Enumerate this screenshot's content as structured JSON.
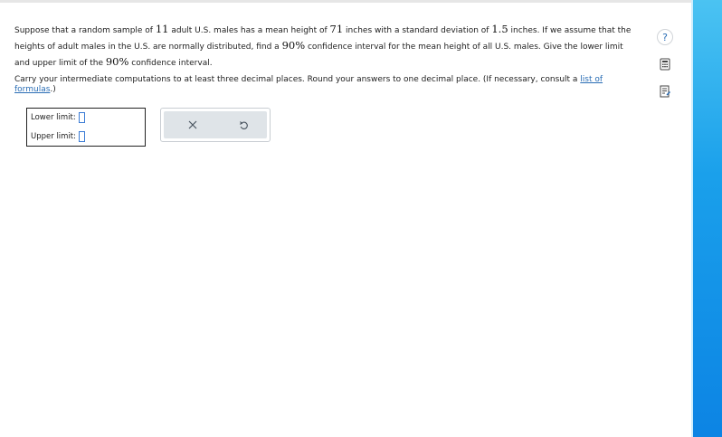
{
  "question": {
    "p1_a": "Suppose that a random sample of ",
    "n": "11",
    "p1_b": " adult U.S. males has a mean height of ",
    "mean": "71",
    "p1_c": " inches with a standard deviation of ",
    "sd": "1.5",
    "p1_d": " inches. If we assume that the heights of adult males in the U.S. are normally distributed, find a ",
    "conf1": "90%",
    "p1_e": " confidence interval for the mean height of all U.S. males. Give the lower limit and upper limit of the ",
    "conf2": "90%",
    "p1_f": " confidence interval.",
    "p2_a": "Carry your intermediate computations to at least three decimal places. Round your answers to one decimal place. (If necessary, consult a ",
    "link": "list of formulas",
    "p2_b": ".)"
  },
  "answers": {
    "lower_label": "Lower limit:",
    "lower_value": "",
    "upper_label": "Upper limit:",
    "upper_value": ""
  },
  "icons": {
    "help": "question-mark-icon",
    "calculator": "calculator-icon",
    "notes": "notes-icon",
    "clear": "x-icon",
    "undo": "undo-icon"
  },
  "help_symbol": "?",
  "colors": {
    "link": "#2a6db5",
    "panel_top": "#4bc3f2",
    "panel_bottom": "#0c84e4",
    "action_bg": "#dfe4e8"
  }
}
